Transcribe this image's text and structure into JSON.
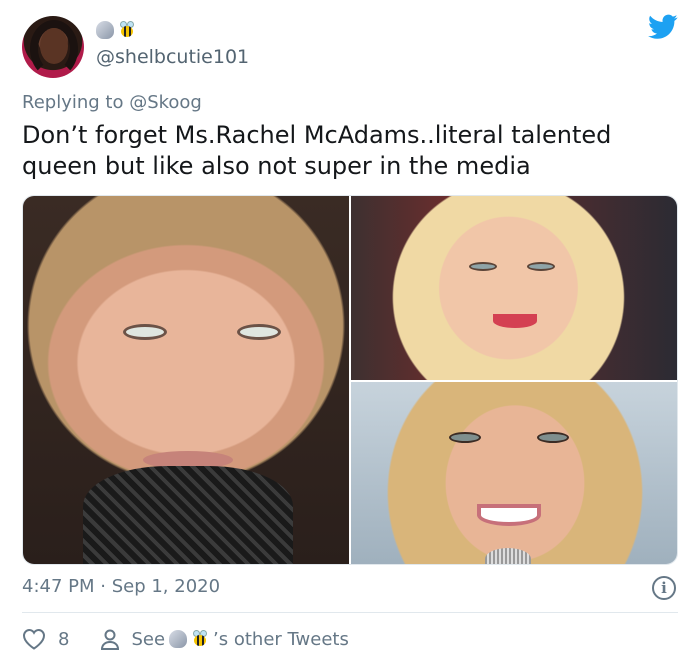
{
  "author": {
    "handle": "@shelbcutie101",
    "name_emojis": [
      "shell-emoji",
      "bee-emoji"
    ]
  },
  "reply": {
    "prefix": "Replying to ",
    "mention": "@Skoog"
  },
  "tweet": {
    "text": "Don’t forget Ms.Rachel McAdams..literal talented queen but like also not super in the media"
  },
  "meta": {
    "timestamp": "4:47 PM · Sep 1, 2020",
    "info_icon": "info-icon"
  },
  "actions": {
    "like_count": "8",
    "see_label": "See",
    "other_tweets_label": "’s other Tweets"
  },
  "colors": {
    "brand": "#1da1f2",
    "muted": "#657786",
    "text": "#14171a"
  }
}
